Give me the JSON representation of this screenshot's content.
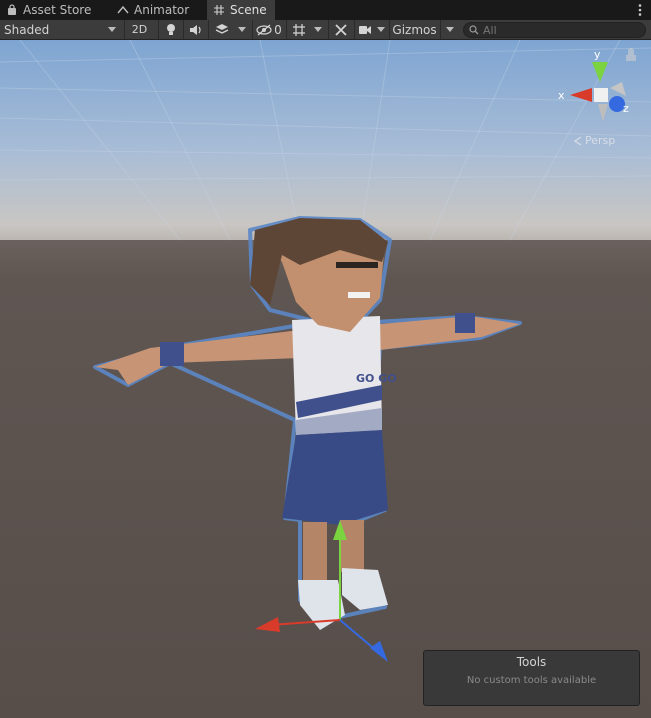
{
  "tabs": [
    {
      "label": "Asset Store",
      "icon": "shopping-bag-icon"
    },
    {
      "label": "Animator",
      "icon": "animator-icon"
    },
    {
      "label": "Scene",
      "icon": "grid-hash-icon",
      "active": true
    }
  ],
  "toolbar": {
    "draw_mode": "Shaded",
    "mode_2d": "2D",
    "hidden_count": "0",
    "gizmos": "Gizmos",
    "search_placeholder": "All"
  },
  "orientation_gizmo": {
    "y_label": "y",
    "x_label": "x",
    "z_label": "z",
    "projection": "Persp"
  },
  "tools_overlay": {
    "title": "Tools",
    "message": "No custom tools available"
  },
  "colors": {
    "sky_top": "#7fa6d3",
    "horizon": "#c9c4be",
    "ground": "#5d5450",
    "selection_outline": "#5b87c7",
    "gizmo_x": "#d93b2b",
    "gizmo_y": "#7ad33f",
    "gizmo_z": "#3569e0"
  }
}
